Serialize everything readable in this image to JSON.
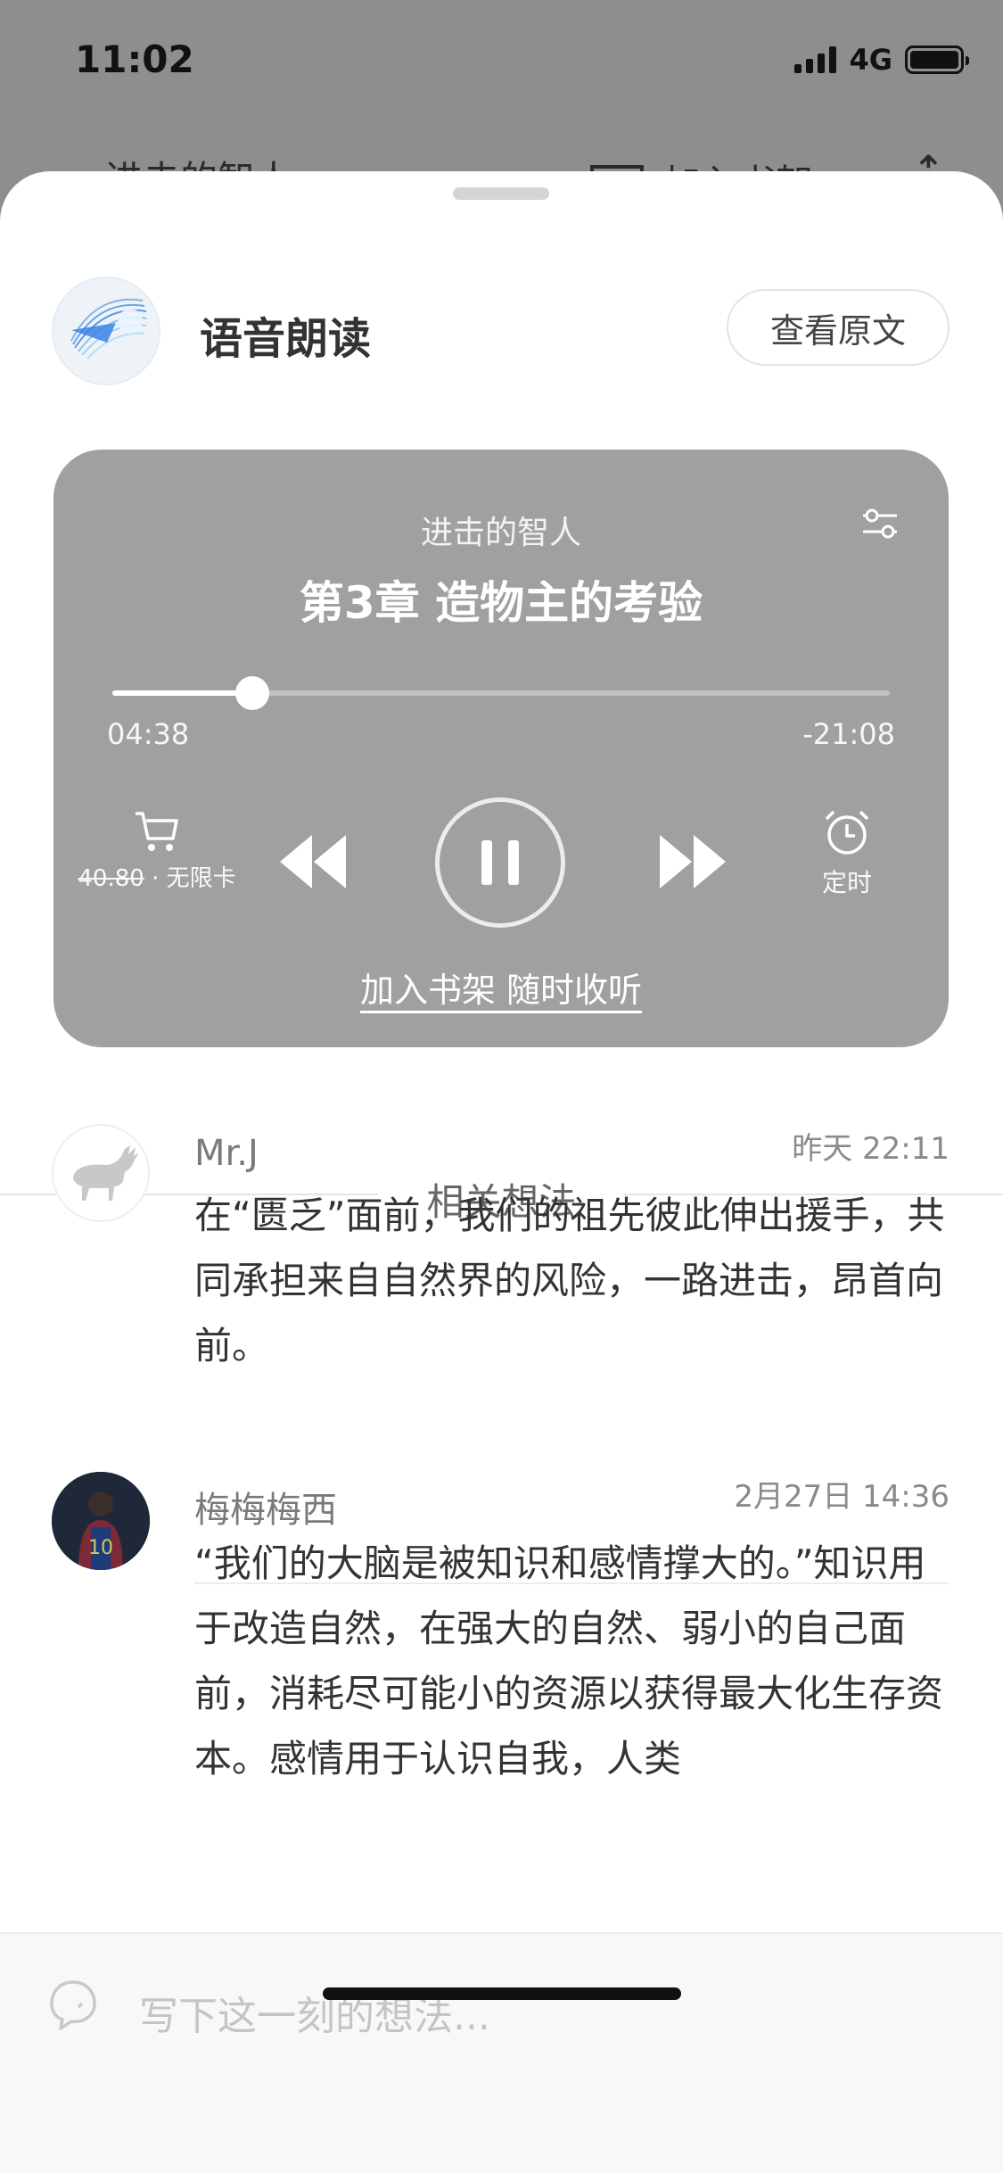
{
  "status_bar": {
    "time": "11:02",
    "network": "4G"
  },
  "underlying_nav": {
    "back_icon": "chevron-left-icon",
    "title": "进击的智人",
    "shelf_label": "加入书架",
    "share_icon": "share-icon"
  },
  "sheet": {
    "title": "语音朗读",
    "view_original_label": "查看原文",
    "logo_icon": "voice-reading-logo"
  },
  "player": {
    "book_title": "进击的智人",
    "chapter_title": "第3章 造物主的考验",
    "elapsed": "04:38",
    "remaining": "-21:08",
    "progress": 0.18,
    "price_old": "40.80",
    "price_separator": " · ",
    "unlimited_label": "无限卡",
    "timer_label": "定时",
    "shelf_cta": "加入书架 随时收听",
    "icons": {
      "settings": "settings-sliders-icon",
      "cart": "cart-icon",
      "rewind": "rewind-icon",
      "pause": "pause-icon",
      "forward": "fast-forward-icon",
      "timer": "alarm-clock-icon"
    }
  },
  "related": {
    "section_title": "相关想法",
    "comments": [
      {
        "user": "Mr.J",
        "time": "昨天 22:11",
        "text": "在“匮乏”面前，我们的祖先彼此伸出援手，共同承担来自自然界的风险，一路进击，昂首向前。"
      },
      {
        "user": "梅梅梅西",
        "time": "2月27日 14:36",
        "text": "“我们的大脑是被知识和感情撑大的。”知识用于改造自然，在强大的自然、弱小的自己面前，消耗尽可能小的资源以获得最大化生存资本。感情用于认识自我，人类"
      }
    ]
  },
  "compose": {
    "placeholder": "写下这一刻的想法...",
    "icon": "thought-bubble-icon"
  },
  "colors": {
    "player_background": "#a0a0a0",
    "overlay": "#8e8e8e",
    "text_primary": "#333333"
  }
}
